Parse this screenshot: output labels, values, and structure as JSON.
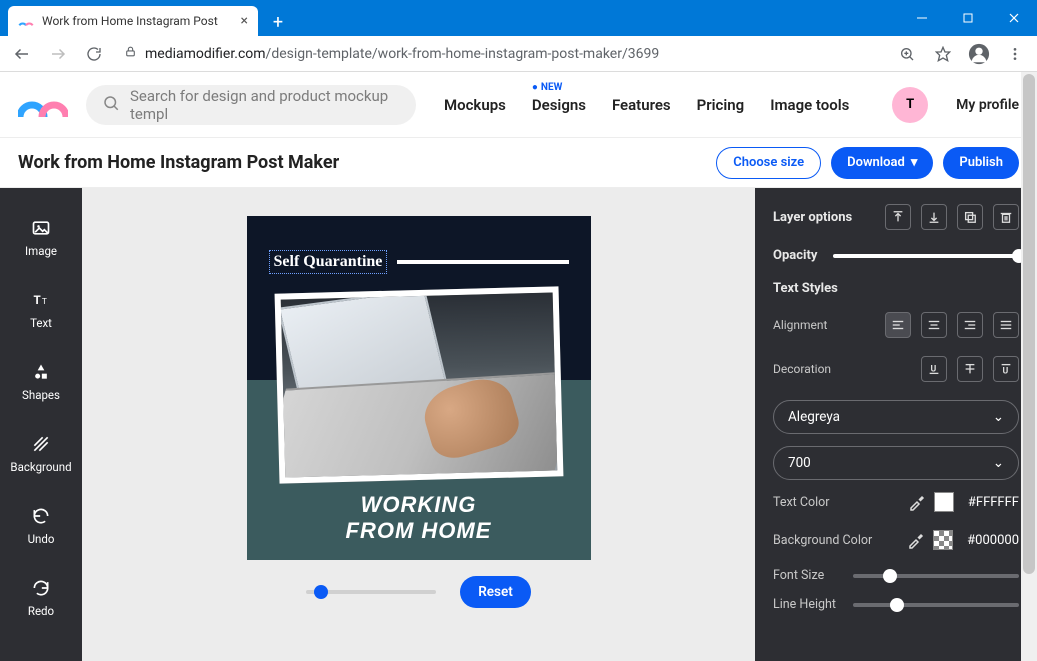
{
  "browser": {
    "tab_title": "Work from Home Instagram Post",
    "url_domain": "mediamodifier.com",
    "url_path": "/design-template/work-from-home-instagram-post-maker/3699"
  },
  "header": {
    "search_placeholder": "Search for design and product mockup templ",
    "nav": {
      "mockups": "Mockups",
      "designs": "Designs",
      "designs_badge": "NEW",
      "features": "Features",
      "pricing": "Pricing",
      "image_tools": "Image tools"
    },
    "avatar_letter": "T",
    "profile": "My profile"
  },
  "subheader": {
    "title": "Work from Home Instagram Post Maker",
    "choose_size": "Choose size",
    "download": "Download",
    "publish": "Publish"
  },
  "left_tools": {
    "image": "Image",
    "text": "Text",
    "shapes": "Shapes",
    "background": "Background",
    "undo": "Undo",
    "redo": "Redo"
  },
  "canvas": {
    "self_q": "Self Quarantine",
    "line1": "WORKING",
    "line2": "FROM HOME",
    "reset": "Reset"
  },
  "panel": {
    "layer_options": "Layer options",
    "opacity": "Opacity",
    "text_styles": "Text Styles",
    "alignment": "Alignment",
    "decoration": "Decoration",
    "font_family": "Alegreya",
    "font_weight": "700",
    "text_color_label": "Text Color",
    "text_color_hex": "#FFFFFF",
    "bg_color_label": "Background Color",
    "bg_color_hex": "#000000",
    "font_size_label": "Font Size",
    "line_height_label": "Line Height"
  }
}
